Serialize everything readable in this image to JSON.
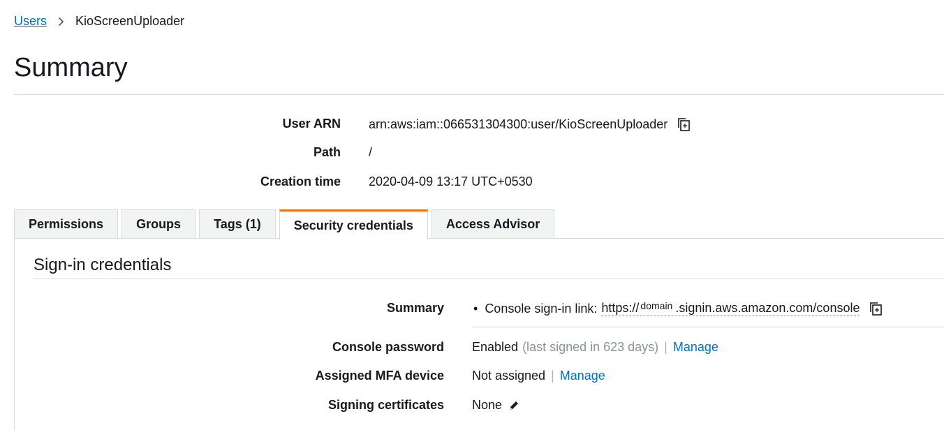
{
  "breadcrumb": {
    "parent": "Users",
    "current": "KioScreenUploader"
  },
  "page": {
    "title": "Summary"
  },
  "summary": {
    "user_arn_label": "User ARN",
    "user_arn_value": "arn:aws:iam::066531304300:user/KioScreenUploader",
    "path_label": "Path",
    "path_value": "/",
    "creation_label": "Creation time",
    "creation_value": "2020-04-09 13:17 UTC+0530"
  },
  "tabs": [
    {
      "label": "Permissions",
      "active": false
    },
    {
      "label": "Groups",
      "active": false
    },
    {
      "label": "Tags (1)",
      "active": false
    },
    {
      "label": "Security credentials",
      "active": true
    },
    {
      "label": "Access Advisor",
      "active": false
    }
  ],
  "signin": {
    "section_title": "Sign-in credentials",
    "summary_label": "Summary",
    "console_link_label": "Console sign-in link:",
    "link_prefix": "https://",
    "link_domain": "domain",
    "link_suffix": ".signin.aws.amazon.com/console",
    "console_password_label": "Console password",
    "console_password_value": "Enabled",
    "console_password_note": "(last signed in 623 days)",
    "manage_label": "Manage",
    "mfa_label": "Assigned MFA device",
    "mfa_value": "Not assigned",
    "signing_label": "Signing certificates",
    "signing_value": "None"
  },
  "icons": {
    "copy": "copy-icon",
    "pencil": "pencil-icon",
    "chevron": "chevron-right-icon"
  },
  "colors": {
    "link": "#0073bb",
    "active_tab_accent": "#ec7211",
    "border": "#d5dbdb",
    "muted": "#879596"
  }
}
